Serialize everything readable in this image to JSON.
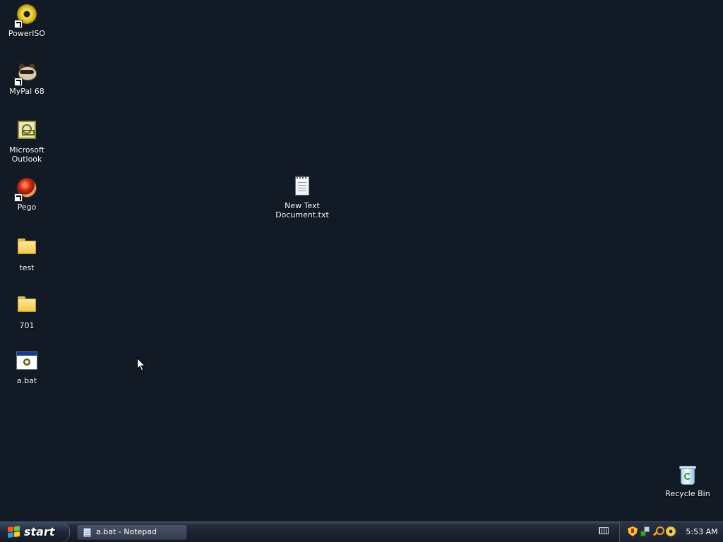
{
  "desktop": {
    "icons": [
      {
        "label": "PowerISO",
        "shortcut": true,
        "icon": "poweriso-disc-icon"
      },
      {
        "label": "MyPal 68",
        "shortcut": true,
        "icon": "raccoon-icon"
      },
      {
        "label": "Microsoft Outlook",
        "shortcut": false,
        "icon": "outlook-icon"
      },
      {
        "label": "Pego",
        "shortcut": true,
        "icon": "pego-red-orb-icon"
      },
      {
        "label": "test",
        "shortcut": false,
        "icon": "folder-icon"
      },
      {
        "label": "701",
        "shortcut": false,
        "icon": "folder-icon"
      },
      {
        "label": "a.bat",
        "shortcut": false,
        "icon": "batch-file-icon"
      },
      {
        "label": "New Text Document.txt",
        "shortcut": false,
        "icon": "notepad-text-file-icon"
      },
      {
        "label": "Recycle Bin",
        "shortcut": false,
        "icon": "recycle-bin-icon"
      }
    ]
  },
  "taskbar": {
    "start_label": "start",
    "tasks": [
      {
        "label": "a.bat - Notepad",
        "icon": "notepad-icon"
      }
    ],
    "tray_icons": [
      "security-shield-icon",
      "network-icon",
      "search-icon",
      "poweriso-tray-icon"
    ],
    "clock": "5:53 AM"
  },
  "colors": {
    "desktop_background": "#121a26",
    "taskbar": "#1c2230",
    "text": "#ffffff"
  }
}
